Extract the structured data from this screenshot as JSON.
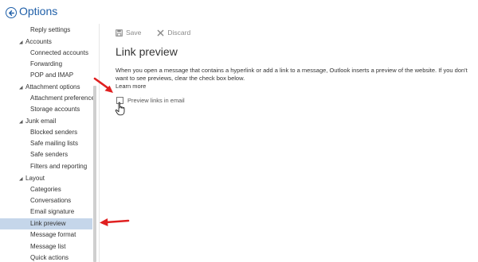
{
  "header": {
    "title": "Options",
    "back_icon": "circle-arrow-left-icon"
  },
  "sidebar": {
    "items": [
      {
        "type": "leaf",
        "label": "Reply settings"
      },
      {
        "type": "group",
        "label": "Accounts"
      },
      {
        "type": "leaf",
        "label": "Connected accounts"
      },
      {
        "type": "leaf",
        "label": "Forwarding"
      },
      {
        "type": "leaf",
        "label": "POP and IMAP"
      },
      {
        "type": "group",
        "label": "Attachment options"
      },
      {
        "type": "leaf",
        "label": "Attachment preference"
      },
      {
        "type": "leaf",
        "label": "Storage accounts"
      },
      {
        "type": "group",
        "label": "Junk email"
      },
      {
        "type": "leaf",
        "label": "Blocked senders"
      },
      {
        "type": "leaf",
        "label": "Safe mailing lists"
      },
      {
        "type": "leaf",
        "label": "Safe senders"
      },
      {
        "type": "leaf",
        "label": "Filters and reporting"
      },
      {
        "type": "group",
        "label": "Layout"
      },
      {
        "type": "leaf",
        "label": "Categories"
      },
      {
        "type": "leaf",
        "label": "Conversations"
      },
      {
        "type": "leaf",
        "label": "Email signature"
      },
      {
        "type": "leaf",
        "label": "Link preview",
        "selected": true
      },
      {
        "type": "leaf",
        "label": "Message format"
      },
      {
        "type": "leaf",
        "label": "Message list"
      },
      {
        "type": "leaf",
        "label": "Quick actions"
      }
    ]
  },
  "toolbar": {
    "save_label": "Save",
    "discard_label": "Discard",
    "save_icon": "floppy-disk-icon",
    "discard_icon": "x-icon"
  },
  "main": {
    "title": "Link preview",
    "description": "When you open a message that contains a hyperlink or add a link to a message, Outlook inserts a preview of the website. If you don't want to see previews, clear the check box below.",
    "learn_more": "Learn more",
    "checkbox_label": "Preview links in email",
    "checkbox_checked": false
  },
  "colors": {
    "accent": "#1f5fa8",
    "selected_bg": "#c5d6ea",
    "annotation_arrow": "#e02020"
  }
}
